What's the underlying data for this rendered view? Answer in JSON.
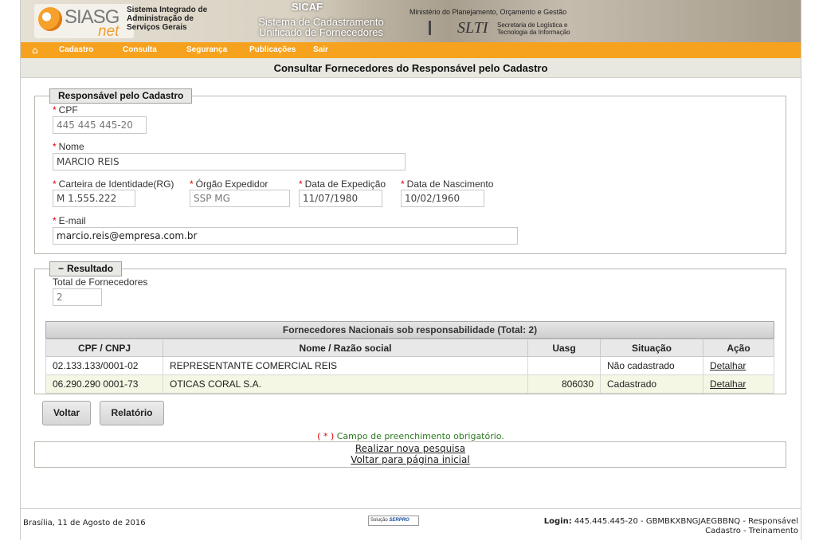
{
  "header": {
    "logo_main": "SIASG",
    "logo_suffix": "net",
    "system_name_lines": [
      "Sistema Integrado de",
      "Administração de",
      "Serviços Gerais"
    ],
    "sicaf_title": "SICAF",
    "sicaf_subtitle_lines": [
      "Sistema de Cadastramento",
      "Unificado de Fornecedores"
    ],
    "ministry": "Ministério do Planejamento, Orçamento e Gestão",
    "slti_logo": "SLTI",
    "slti_desc_lines": [
      "Secretaria de Logística e",
      "Tecnologia da Informação"
    ]
  },
  "nav": {
    "home_icon": "home-icon",
    "items": [
      "Cadastro",
      "Consulta",
      "Segurança",
      "Publicações",
      "Sair"
    ]
  },
  "page_title": "Consultar Fornecedores do Responsável pelo Cadastro",
  "responsavel": {
    "legend": "Responsável pelo Cadastro",
    "required_mark": "*",
    "cpf_label": "CPF",
    "cpf_value": "445 445 445-20",
    "nome_label": "Nome",
    "nome_value": "MARCIO REIS",
    "rg_label": "Carteira de Identidade(RG)",
    "rg_value": "M 1.555.222",
    "orgao_label": "Órgão Expedidor",
    "orgao_value": "SSP MG",
    "data_exp_label": "Data de Expedição",
    "data_exp_value": "11/07/1980",
    "data_nasc_label": "Data de Nascimento",
    "data_nasc_value": "10/02/1960",
    "email_label": "E-mail",
    "email_value": "marcio.reis@empresa.com.br"
  },
  "resultado": {
    "legend": "Resultado",
    "collapse_symbol": "−",
    "total_label": "Total de Fornecedores",
    "total_value": "2",
    "table_title": "Fornecedores Nacionais sob responsabilidade (Total: 2)",
    "columns": [
      "CPF / CNPJ",
      "Nome / Razão social",
      "Uasg",
      "Situação",
      "Ação"
    ],
    "rows": [
      {
        "cnpj": "02.133.133/0001-02",
        "nome": "REPRESENTANTE COMERCIAL REIS",
        "uasg": "",
        "situacao": "Não cadastrado",
        "acao": "Detalhar"
      },
      {
        "cnpj": "06.290.290 0001-73",
        "nome": "OTICAS CORAL S.A.",
        "uasg": "806030",
        "situacao": "Cadastrado",
        "acao": "Detalhar"
      }
    ]
  },
  "buttons": {
    "voltar": "Voltar",
    "relatorio": "Relatório"
  },
  "required_note": {
    "star": "( * )",
    "text": "Campo de preenchimento obrigatório."
  },
  "links": {
    "nova_pesquisa": "Realizar nova pesquisa",
    "pagina_inicial": "Voltar para página inicial"
  },
  "footer": {
    "date": "Brasília, 11 de Agosto de 2016",
    "logo_small": "Solução",
    "logo_brand": "SERPRO",
    "login_label": "Login:",
    "login_value": "445.445.445-20 - GBMBKXBNGJAEGBBNQ - Responsável Cadastro - Treinamento"
  }
}
